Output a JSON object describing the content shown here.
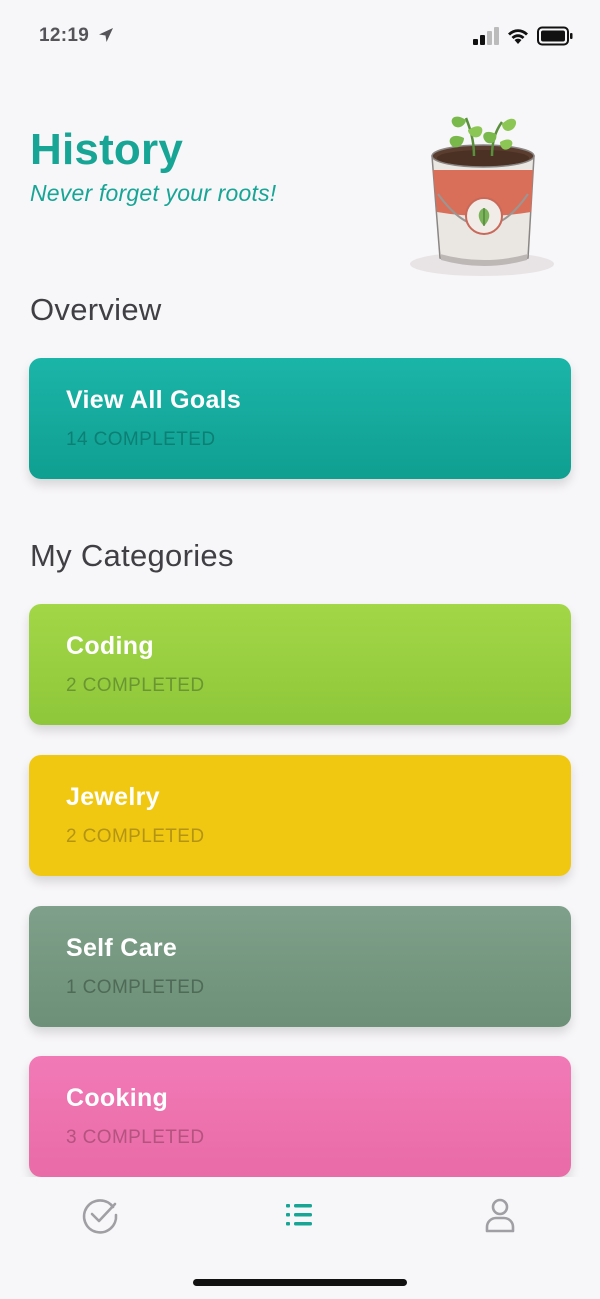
{
  "status_bar": {
    "time": "12:19",
    "icons": [
      "location-arrow-icon",
      "cellular-signal-icon",
      "wifi-icon",
      "battery-icon"
    ]
  },
  "header": {
    "title": "History",
    "subtitle": "Never forget your roots!",
    "illustration": "plant-in-can-illustration"
  },
  "overview": {
    "heading": "Overview",
    "card": {
      "title": "View All Goals",
      "count": "14 COMPLETED",
      "color": "#17b0a2"
    }
  },
  "categories": {
    "heading": "My Categories",
    "items": [
      {
        "title": "Coding",
        "count": "2 COMPLETED",
        "color": "#9ad143"
      },
      {
        "title": "Jewelry",
        "count": "2 COMPLETED",
        "color": "#f0c812"
      },
      {
        "title": "Self Care",
        "count": "1 COMPLETED",
        "color": "#779a82"
      },
      {
        "title": "Cooking",
        "count": "3 COMPLETED",
        "color": "#ee74b1"
      }
    ]
  },
  "tab_bar": {
    "tabs": [
      {
        "icon": "check-circle-icon",
        "active": false
      },
      {
        "icon": "list-icon",
        "active": true
      },
      {
        "icon": "person-icon",
        "active": false
      }
    ],
    "active_color": "#17a596",
    "inactive_color": "#a0a0a4"
  }
}
